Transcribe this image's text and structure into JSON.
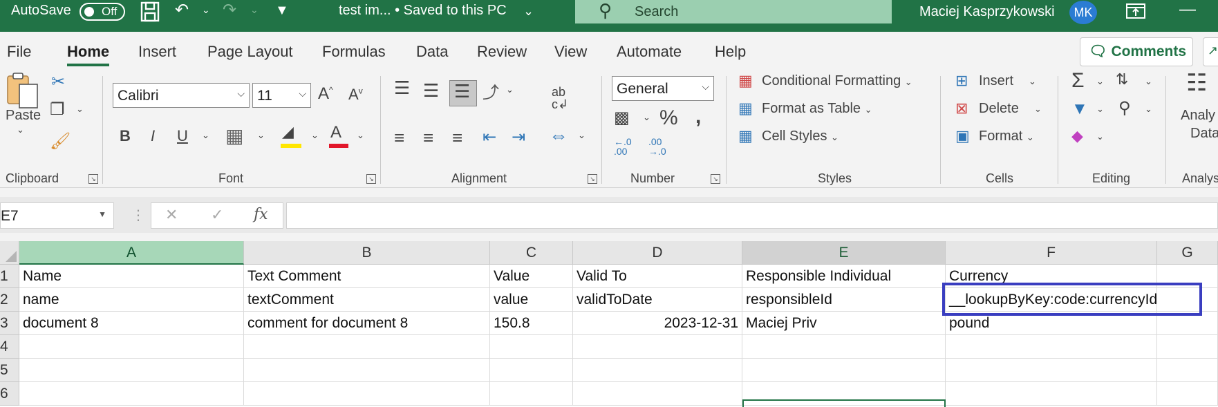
{
  "titlebar": {
    "autosave_label": "AutoSave",
    "autosave_state": "Off",
    "doc_title": "test im... • Saved to this PC",
    "search_placeholder": "Search",
    "user_name": "Maciej Kasprzykowski",
    "user_initials": "MK"
  },
  "menu": {
    "tabs": [
      "File",
      "Home",
      "Insert",
      "Page Layout",
      "Formulas",
      "Data",
      "Review",
      "View",
      "Automate",
      "Help"
    ],
    "active_tab": "Home",
    "comments_label": "Comments"
  },
  "ribbon": {
    "clipboard": {
      "paste_label": "Paste",
      "group_label": "Clipboard"
    },
    "font": {
      "font_name": "Calibri",
      "font_size": "11",
      "group_label": "Font"
    },
    "alignment": {
      "group_label": "Alignment"
    },
    "number": {
      "format": "General",
      "group_label": "Number"
    },
    "styles": {
      "items": [
        "Conditional Formatting",
        "Format as Table",
        "Cell Styles"
      ],
      "group_label": "Styles"
    },
    "cells": {
      "items": [
        "Insert",
        "Delete",
        "Format"
      ],
      "group_label": "Cells"
    },
    "editing": {
      "group_label": "Editing"
    },
    "analysis": {
      "label_line1": "Analy",
      "label_line2": "Data",
      "group_label": "Analys"
    }
  },
  "formula_bar": {
    "name_box": "E7",
    "formula": ""
  },
  "sheet": {
    "columns": [
      "A",
      "B",
      "C",
      "D",
      "E",
      "F",
      "G"
    ],
    "rows": [
      "1",
      "2",
      "3",
      "4",
      "5",
      "6"
    ],
    "cells": [
      [
        "Name",
        "Text Comment",
        "Value",
        "Valid To",
        "Responsible Individual",
        "Currency",
        ""
      ],
      [
        "name",
        "textComment",
        "value",
        "validToDate",
        "responsibleId",
        "__lookupByKey:code:currencyId",
        ""
      ],
      [
        "document 8",
        "comment for document 8",
        "150.8",
        "2023-12-31",
        "Maciej Priv",
        "pound",
        ""
      ]
    ]
  },
  "colors": {
    "accent": "#217346",
    "highlight_box": "#3a3ec0"
  }
}
